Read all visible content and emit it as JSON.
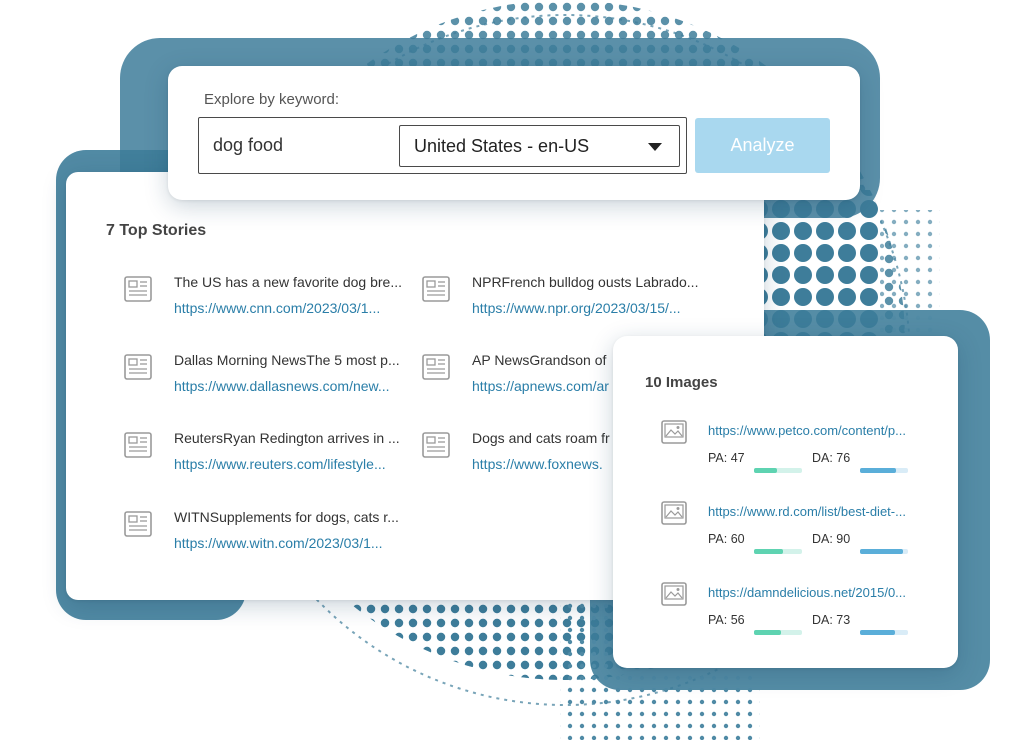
{
  "search": {
    "label": "Explore by keyword:",
    "keyword_value": "dog food",
    "locale_selected": "United States - en-US",
    "analyze_label": "Analyze"
  },
  "stories": {
    "title": "7 Top Stories",
    "items": [
      {
        "title": "The US has a new favorite dog bre...",
        "url": "https://www.cnn.com/2023/03/1..."
      },
      {
        "title": "NPRFrench bulldog ousts Labrado...",
        "url": "https://www.npr.org/2023/03/15/..."
      },
      {
        "title": "Dallas Morning NewsThe 5 most p...",
        "url": "https://www.dallasnews.com/new..."
      },
      {
        "title": "AP NewsGrandson of",
        "url": "https://apnews.com/ar"
      },
      {
        "title": "ReutersRyan Redington arrives in ...",
        "url": "https://www.reuters.com/lifestyle..."
      },
      {
        "title": "Dogs and cats roam fr",
        "url": "https://www.foxnews."
      },
      {
        "title": "WITNSupplements for dogs, cats r...",
        "url": "https://www.witn.com/2023/03/1..."
      }
    ]
  },
  "images": {
    "title": "10 Images",
    "items": [
      {
        "url": "https://www.petco.com/content/p...",
        "pa_label": "PA: 47",
        "pa": 47,
        "da_label": "DA: 76",
        "da": 76
      },
      {
        "url": "https://www.rd.com/list/best-diet-...",
        "pa_label": "PA: 60",
        "pa": 60,
        "da_label": "DA: 90",
        "da": 90
      },
      {
        "url": "https://damndelicious.net/2015/0...",
        "pa_label": "PA: 56",
        "pa": 56,
        "da_label": "DA: 73",
        "da": 73
      }
    ]
  },
  "colors": {
    "link": "#2a7ea8",
    "analyze_button": "#a9d8ef",
    "pa_bar": "#5ed3b1",
    "da_bar": "#5aaed9",
    "backdrop": "#3e7d9a"
  },
  "icons": {
    "story": "newspaper-icon",
    "image": "image-icon",
    "dropdown": "caret-down-icon"
  }
}
